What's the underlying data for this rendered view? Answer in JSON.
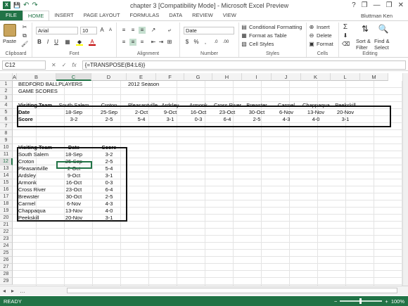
{
  "window": {
    "title": "chapter 3 [Compatibility Mode] - Microsoft Excel Preview",
    "controls": [
      "?",
      "❐",
      "—",
      "❐",
      "✕"
    ]
  },
  "qat": {
    "save": "💾",
    "undo": "↶",
    "redo": "↷"
  },
  "tabs": [
    "FILE",
    "HOME",
    "INSERT",
    "PAGE LAYOUT",
    "FORMULAS",
    "DATA",
    "REVIEW",
    "VIEW"
  ],
  "active_tab": "HOME",
  "user": "Bluttman Ken",
  "ribbon": {
    "clipboard": {
      "label": "Clipboard",
      "paste": "Paste"
    },
    "font": {
      "label": "Font",
      "name": "Arial",
      "size": "10"
    },
    "alignment": {
      "label": "Alignment"
    },
    "number": {
      "label": "Number",
      "format": "Date",
      "currency": "$",
      "percent": "%",
      "comma": ","
    },
    "styles": {
      "label": "Styles",
      "conditional": "Conditional Formatting",
      "format_table": "Format as Table",
      "cell_styles": "Cell Styles"
    },
    "cells": {
      "label": "Cells",
      "insert": "Insert",
      "delete": "Delete",
      "format": "Format"
    },
    "editing": {
      "label": "Editing",
      "sort": "Sort &",
      "filter": "Filter",
      "find": "Find &",
      "select": "Select"
    }
  },
  "formula_bar": {
    "name_box": "C12",
    "formula": "{=TRANSPOSE(B4:L6)}"
  },
  "columns": [
    "A",
    "B",
    "C",
    "D",
    "E",
    "F",
    "G",
    "H",
    "I",
    "J",
    "K",
    "L",
    "M"
  ],
  "rows": [
    "1",
    "2",
    "3",
    "4",
    "5",
    "6",
    "7",
    "8",
    "9",
    "10",
    "11",
    "12",
    "13",
    "14",
    "15",
    "16",
    "17",
    "18",
    "19",
    "20",
    "21",
    "22",
    "23",
    "24",
    "25",
    "26",
    "27",
    "28",
    "29"
  ],
  "selected": {
    "column": "C",
    "row": "12"
  },
  "sheet": {
    "title1": "BEDFORD BALLPLAYERS",
    "season": "2012 Season",
    "title2": "GAME SCORES",
    "hdr_team": "Visiting Team",
    "hdr_date": "Date",
    "hdr_score": "Score",
    "teams": [
      "South Salem",
      "Croton",
      "Pleasantville",
      "Ardsley",
      "Armonk",
      "Cross River",
      "Brewster",
      "Carmel",
      "Chappaqua",
      "Peekskill"
    ],
    "dates": [
      "18-Sep",
      "25-Sep",
      "2-Oct",
      "9-Oct",
      "16-Oct",
      "23-Oct",
      "30-Oct",
      "6-Nov",
      "13-Nov",
      "20-Nov"
    ],
    "scores": [
      "3-2",
      "2-5",
      "5-4",
      "3-1",
      "0-3",
      "6-4",
      "2-5",
      "4-3",
      "4-0",
      "3-1"
    ]
  },
  "sheet_nav": {
    "prev": "◂",
    "next": "▸",
    "more": "…"
  },
  "status": {
    "ready": "READY",
    "zoom": "100%"
  }
}
